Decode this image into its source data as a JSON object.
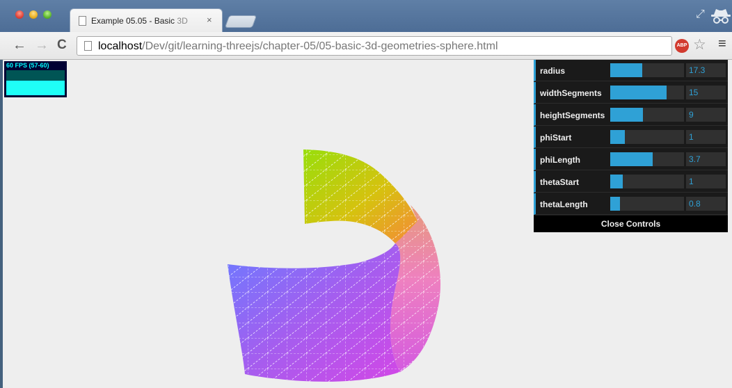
{
  "browser": {
    "tab_title": "Example 05.05 - Basic ",
    "tab_title_faded": "3D",
    "tab_close": "×",
    "url_host": "localhost",
    "url_path": "/Dev/git/learning-threejs/chapter-05/05-basic-3d-geometries-sphere.html",
    "abp_label": "ABP",
    "icons": [
      "back-icon",
      "forward-icon",
      "reload-icon",
      "page-icon",
      "adblock-icon",
      "star-icon",
      "menu-icon",
      "incognito-icon",
      "fullscreen-icon"
    ]
  },
  "stats": {
    "fps_text": "60 FPS (57-60)",
    "fps_value": 60,
    "fps_max": 60
  },
  "controls": {
    "rows": [
      {
        "label": "radius",
        "value": "17.3",
        "fill": 0.43
      },
      {
        "label": "widthSegments",
        "value": "15",
        "fill": 0.76
      },
      {
        "label": "heightSegments",
        "value": "9",
        "fill": 0.44
      },
      {
        "label": "phiStart",
        "value": "1",
        "fill": 0.2
      },
      {
        "label": "phiLength",
        "value": "3.7",
        "fill": 0.58
      },
      {
        "label": "thetaStart",
        "value": "1",
        "fill": 0.17
      },
      {
        "label": "thetaLength",
        "value": "0.8",
        "fill": 0.13
      }
    ],
    "close_label": "Close Controls"
  },
  "colors": {
    "accent": "#2fa1d6",
    "viewport_bg": "#eeeeee",
    "fps": "#00ffff"
  }
}
